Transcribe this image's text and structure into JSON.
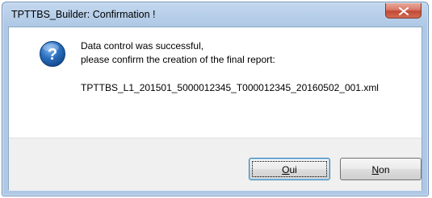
{
  "window": {
    "title": "TPTTBS_Builder: Confirmation !"
  },
  "icons": {
    "dialog_icon": "question-icon",
    "close_icon": "close-icon"
  },
  "message": {
    "line1": "Data control was successful,",
    "line2": "please confirm the creation of the final report:",
    "filename": "TPTTBS_L1_201501_5000012345_T000012345_20160502_001.xml"
  },
  "buttons": {
    "yes_label": "Oui",
    "no_label": "Non"
  },
  "colors": {
    "titlebar": "#b5cde8",
    "close_button": "#c24a36",
    "icon_blue": "#2a6fbf",
    "footer": "#f0f0f0"
  }
}
